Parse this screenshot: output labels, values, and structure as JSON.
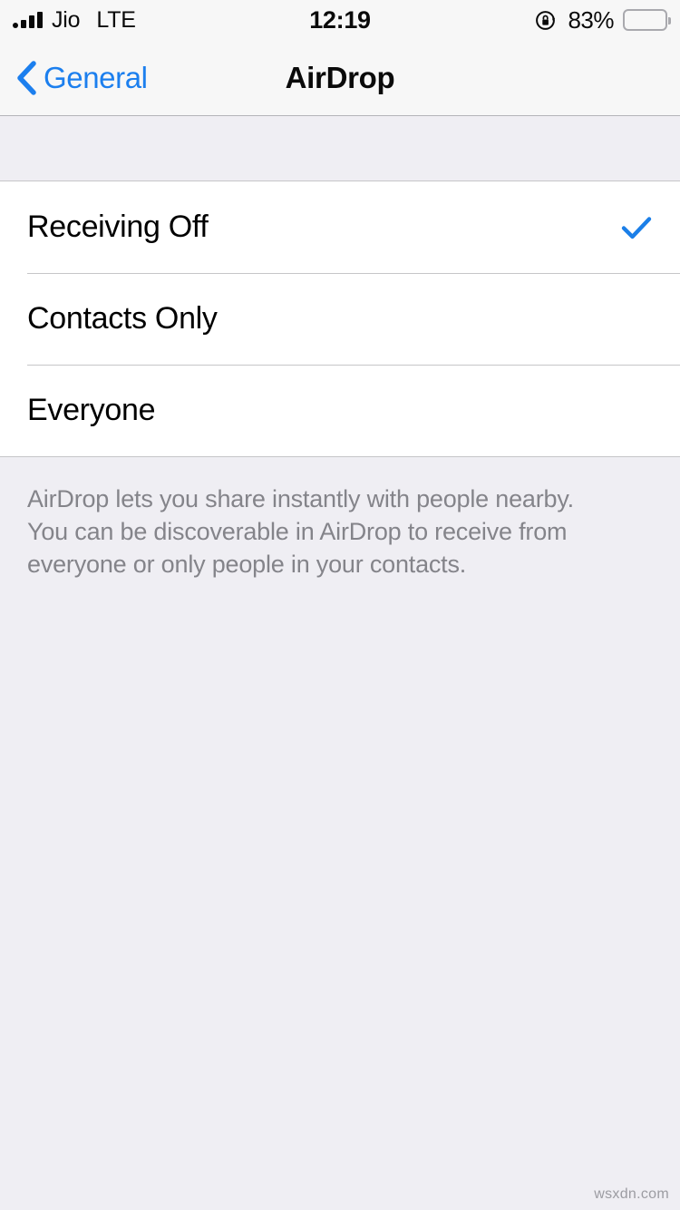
{
  "status_bar": {
    "signal_icon": "signal-bars-icon",
    "carrier": "Jio",
    "radio_type": "LTE",
    "time": "12:19",
    "rotation_lock_icon": "rotation-lock-icon",
    "battery_percent_label": "83%",
    "battery_level": 83,
    "battery_icon": "battery-icon"
  },
  "nav_bar": {
    "back_icon": "chevron-left-icon",
    "back_label": "General",
    "title": "AirDrop"
  },
  "options": [
    {
      "label": "Receiving Off",
      "selected": true,
      "check_icon": "checkmark-icon"
    },
    {
      "label": "Contacts Only",
      "selected": false,
      "check_icon": "checkmark-icon"
    },
    {
      "label": "Everyone",
      "selected": false,
      "check_icon": "checkmark-icon"
    }
  ],
  "footer": {
    "note": "AirDrop lets you share instantly with people nearby. You can be discoverable in AirDrop to receive from everyone or only people in your contacts."
  },
  "watermark": {
    "text": "wsxdn.com"
  },
  "colors": {
    "accent_blue": "#1C7FEE",
    "checkmark_blue": "#1B7FE8",
    "page_background": "#EFEEF3",
    "bar_background": "#F7F7F7",
    "row_background": "#FFFFFF",
    "separator": "#C6C6C8",
    "footer_text": "#84848A"
  }
}
